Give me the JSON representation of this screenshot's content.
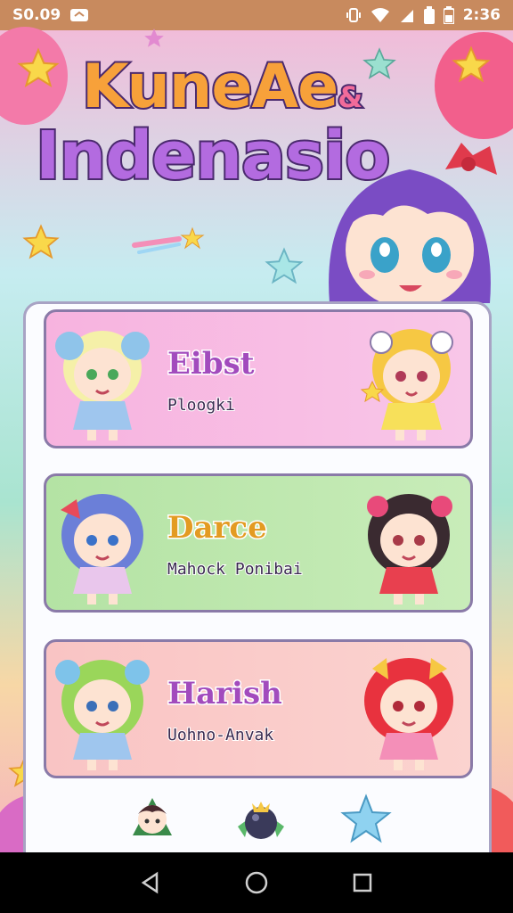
{
  "status_bar": {
    "left_text": "S0.09",
    "time": "2:36"
  },
  "title": {
    "line1": "KuneAe",
    "line1_suffix": "&",
    "line2": "Indenasio"
  },
  "modes": [
    {
      "title": "Eibst",
      "subtitle": "Ploogki"
    },
    {
      "title": "Darce",
      "subtitle": "Mahock Ponibai"
    },
    {
      "title": "Harish",
      "subtitle": "Uohno-Anvak"
    }
  ],
  "colors": {
    "status_bar": "#c88a5e",
    "card_pink": "#f7b3df",
    "card_green": "#b4e3a4",
    "card_peach": "#f9c4c4",
    "title_purple": "#a24bbd",
    "title_orange": "#e39b22"
  },
  "icons": {
    "bottom": [
      "character-icon",
      "bomb-icon",
      "star-icon"
    ],
    "nav": [
      "back-icon",
      "home-icon",
      "recents-icon"
    ]
  }
}
